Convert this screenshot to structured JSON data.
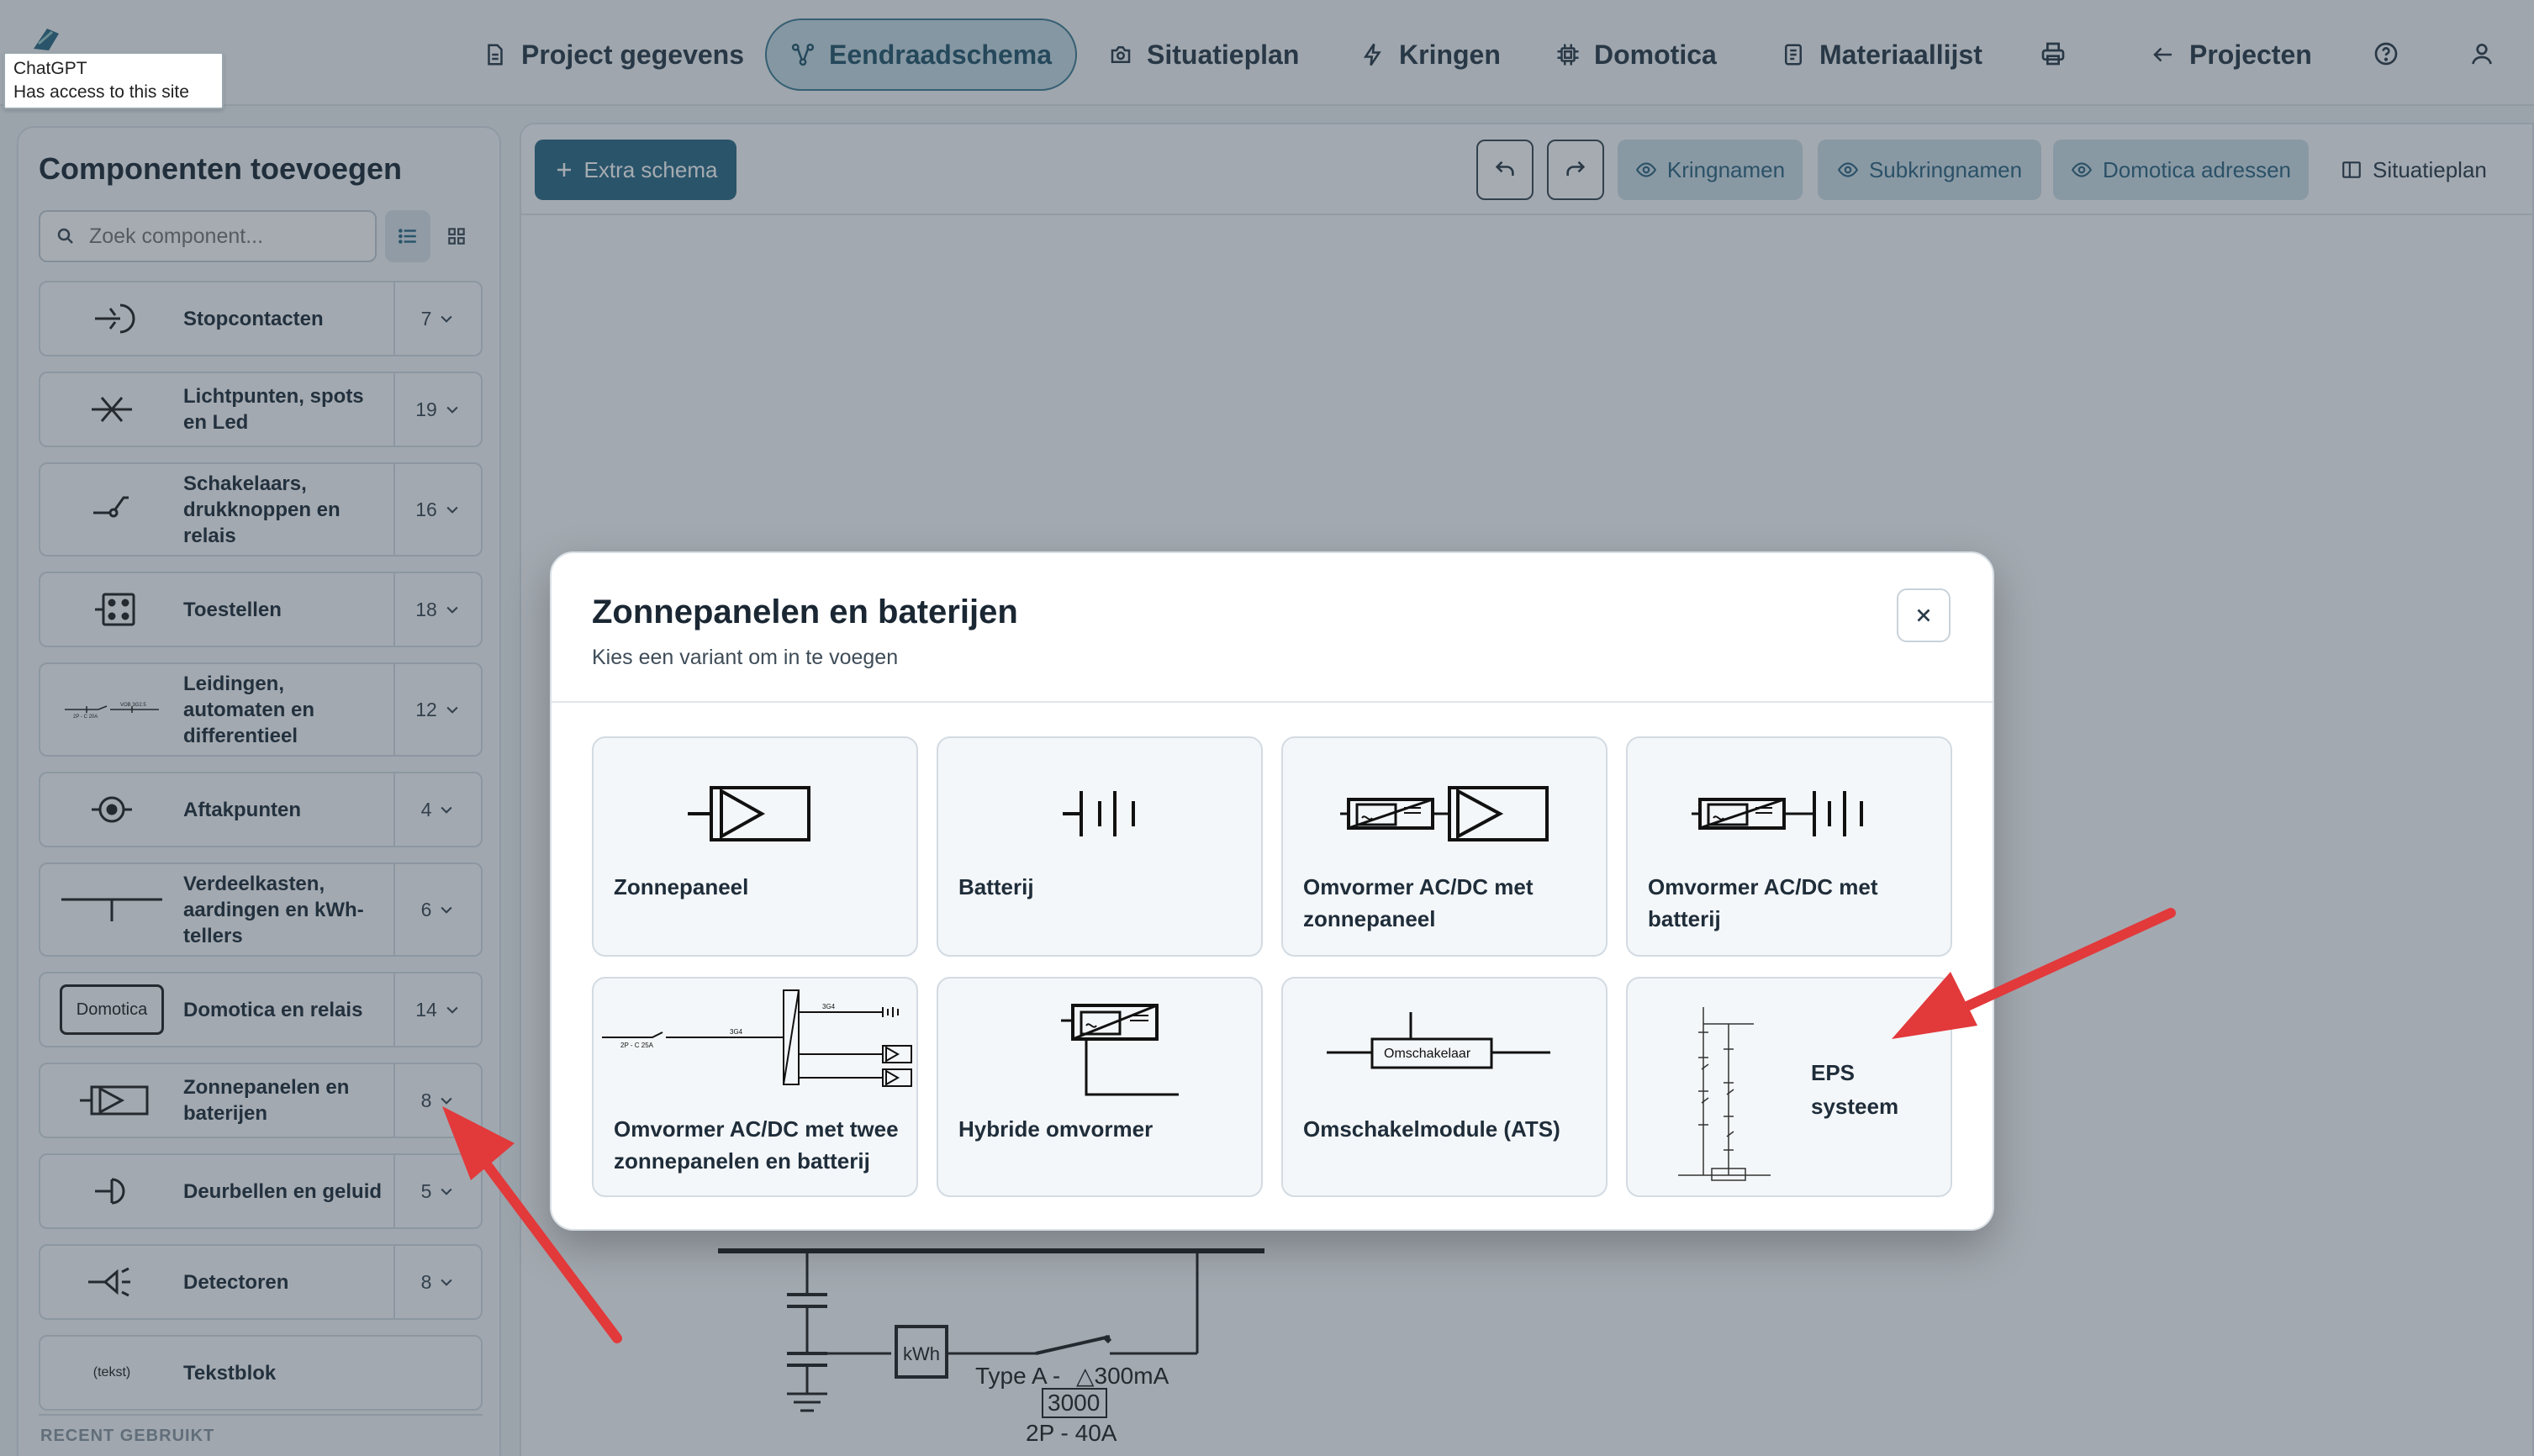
{
  "tooltip": {
    "line1": "ChatGPT",
    "line2": "Has access to this site"
  },
  "nav": {
    "items": [
      {
        "label": "Project gegevens",
        "icon": "document-icon"
      },
      {
        "label": "Eendraadschema",
        "icon": "schema-icon",
        "active": true
      },
      {
        "label": "Situatieplan",
        "icon": "camera-icon"
      },
      {
        "label": "Kringen",
        "icon": "lightning-icon"
      },
      {
        "label": "Domotica",
        "icon": "chip-icon"
      },
      {
        "label": "Materiaallijst",
        "icon": "list-icon"
      }
    ],
    "projects_label": "Projecten"
  },
  "sidebar": {
    "title": "Componenten toevoegen",
    "search_placeholder": "Zoek component...",
    "categories": [
      {
        "label": "Stopcontacten",
        "count": "7"
      },
      {
        "label": "Lichtpunten, spots en Led",
        "count": "19"
      },
      {
        "label": "Schakelaars, drukknoppen en relais",
        "count": "16"
      },
      {
        "label": "Toestellen",
        "count": "18"
      },
      {
        "label": "Leidingen, automaten en differentieel",
        "count": "12"
      },
      {
        "label": "Aftakpunten",
        "count": "4"
      },
      {
        "label": "Verdeelkasten, aardingen en kWh-tellers",
        "count": "6"
      },
      {
        "label": "Domotica en relais",
        "count": "14"
      },
      {
        "label": "Zonnepanelen en baterijen",
        "count": "8"
      },
      {
        "label": "Deurbellen en geluid",
        "count": "5"
      },
      {
        "label": "Detectoren",
        "count": "8"
      },
      {
        "label": "Tekstblok",
        "count": ""
      }
    ],
    "domotica_icon_text": "Domotica",
    "tekst_icon_text": "(tekst)",
    "recent_label": "RECENT GEBRUIKT"
  },
  "toolbar": {
    "extra_schema": "Extra schema",
    "kringnamen": "Kringnamen",
    "subkringnamen": "Subkringnamen",
    "domotica_adressen": "Domotica adressen",
    "situatieplan": "Situatieplan"
  },
  "diagram": {
    "kwh": "kWh",
    "type_label": "Type A -",
    "ma_label": "△300mA",
    "value_3000": "3000",
    "rating": "2P - 40A"
  },
  "modal": {
    "title": "Zonnepanelen en baterijen",
    "subtitle": "Kies een variant om in te voegen",
    "cards": [
      {
        "label": "Zonnepaneel"
      },
      {
        "label": "Batterij"
      },
      {
        "label": "Omvormer AC/DC met zonnepaneel"
      },
      {
        "label": "Omvormer AC/DC met batterij"
      },
      {
        "label": "Omvormer AC/DC met twee zonnepanelen en batterij"
      },
      {
        "label": "Hybride omvormer"
      },
      {
        "label": "Omschakelmodule (ATS)"
      },
      {
        "label": "EPS systeem"
      }
    ],
    "omschakelaar_text": "Omschakelaar"
  },
  "colors": {
    "primary": "#2c6a85",
    "arrow": "#e2393b",
    "overlay": "rgba(40,55,70,0.42)"
  }
}
